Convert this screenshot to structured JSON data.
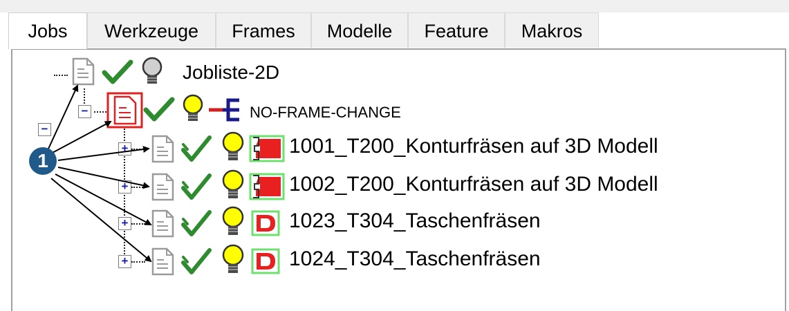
{
  "tabs": [
    "Jobs",
    "Werkzeuge",
    "Frames",
    "Modelle",
    "Feature",
    "Makros"
  ],
  "active_tab": "Jobs",
  "tree": {
    "root": {
      "label": "Jobliste-2D",
      "expander": "−"
    },
    "folder": {
      "label": "NO-FRAME-CHANGE",
      "expander": "−"
    },
    "jobs": [
      {
        "label": "1001_T200_Konturfräsen auf 3D Modell",
        "expander": "+"
      },
      {
        "label": "1002_T200_Konturfräsen auf 3D Modell",
        "expander": "+"
      },
      {
        "label": "1023_T304_Taschenfräsen",
        "expander": "+"
      },
      {
        "label": "1024_T304_Taschenfräsen",
        "expander": "+"
      }
    ]
  },
  "callout": {
    "number": "1"
  },
  "colors": {
    "check_green": "#2e8b2e",
    "bulb_yellow": "#ffff00",
    "highlight_red": "#e02020",
    "callout_blue": "#1f5a8a",
    "expander_blue": "#1a1fa8"
  },
  "icons": [
    "document-icon",
    "check-icon",
    "light-bulb-icon",
    "frame-branch-icon",
    "contour-feature-icon",
    "pocket-feature-icon"
  ]
}
